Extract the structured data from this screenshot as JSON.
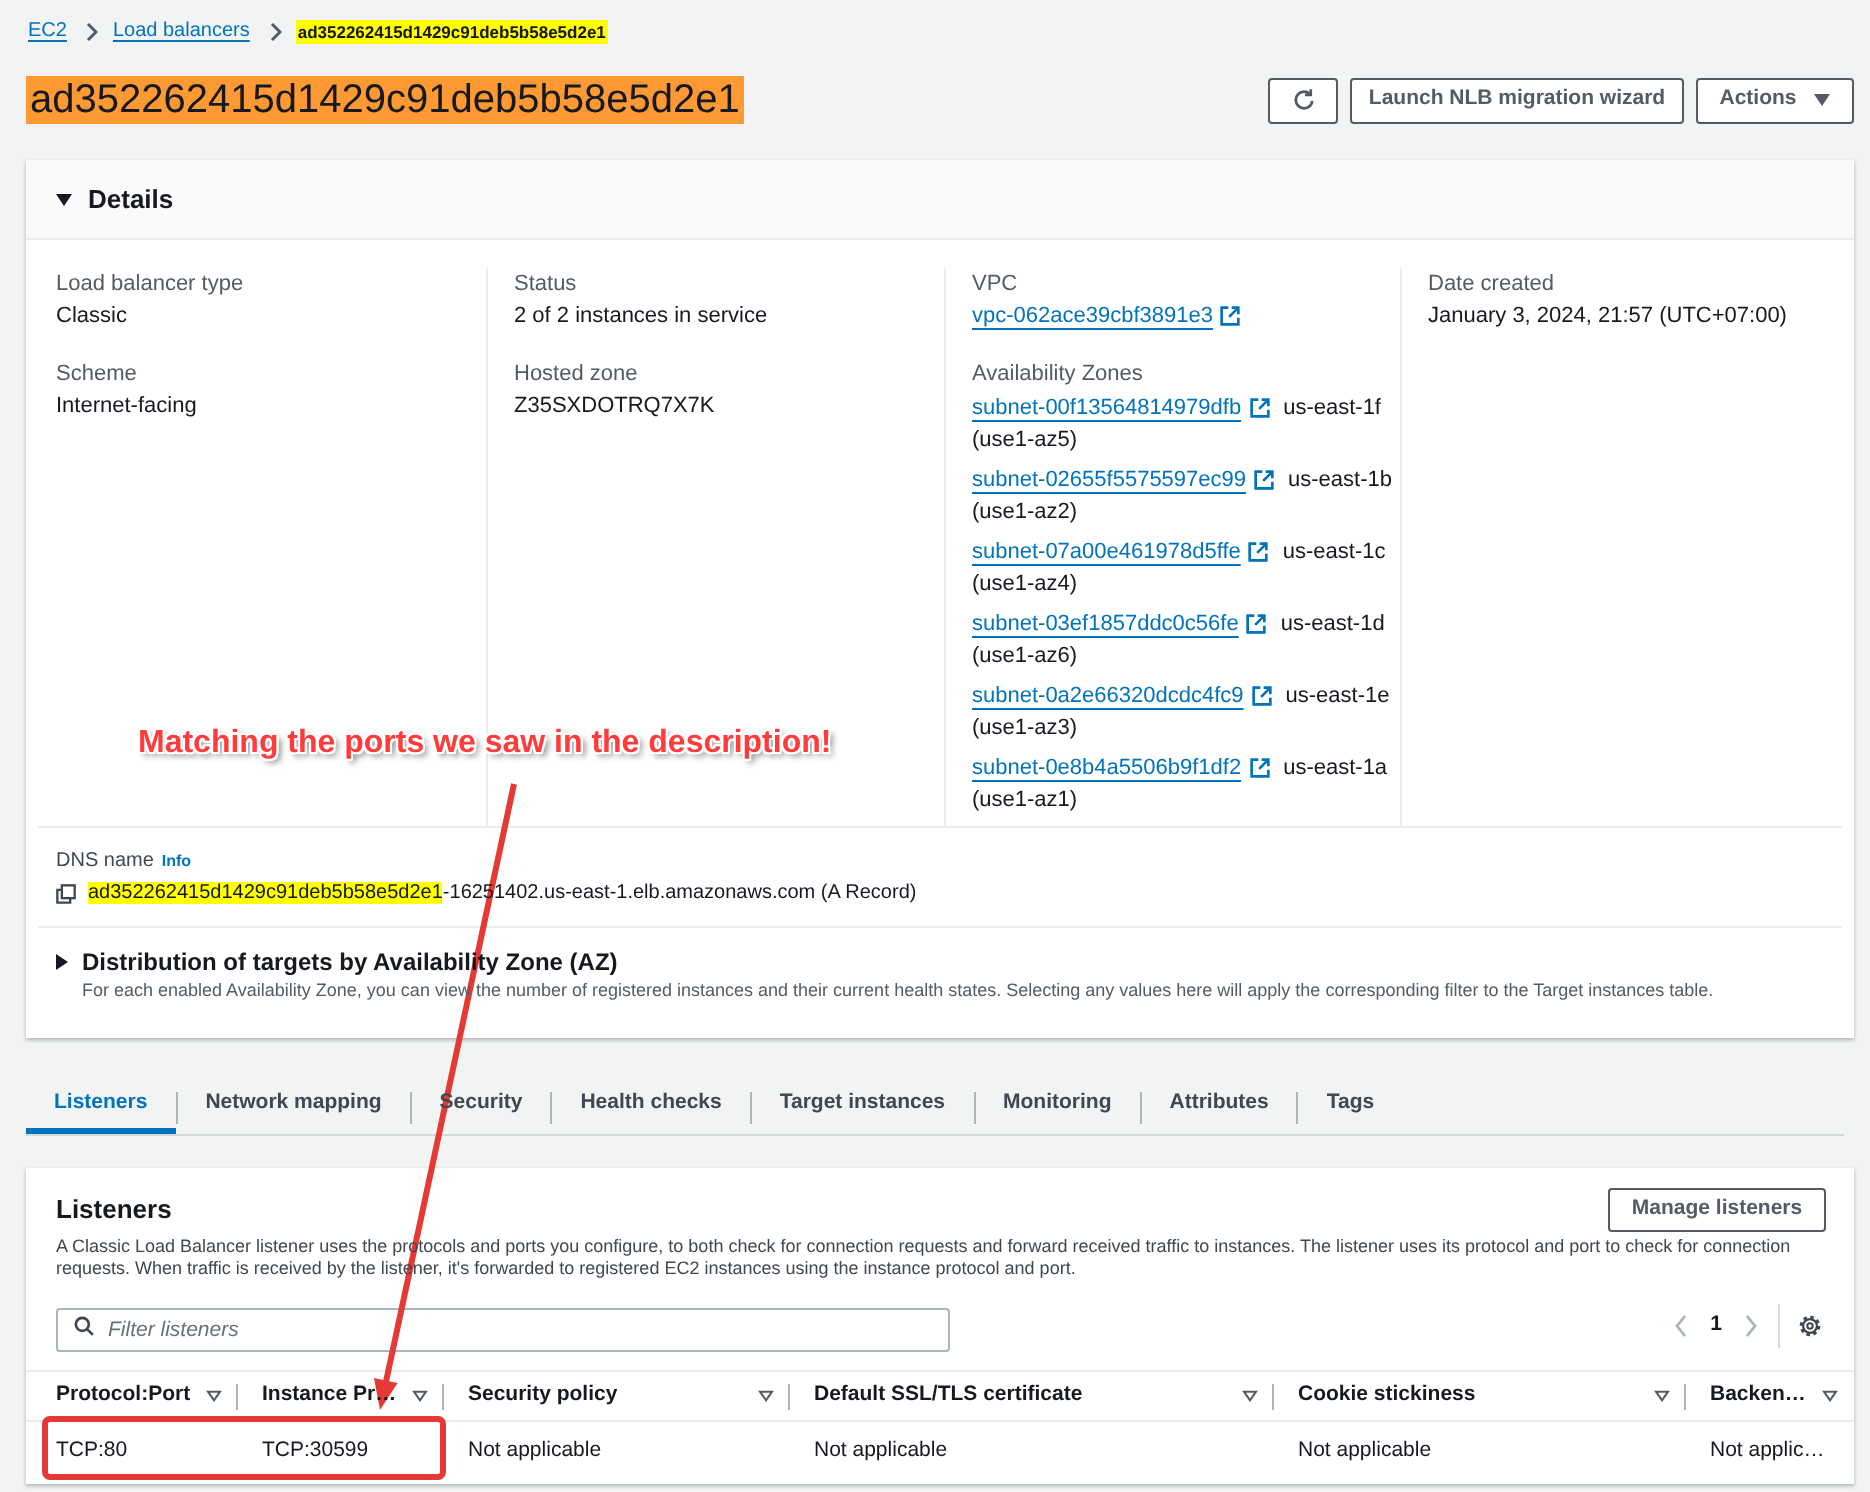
{
  "breadcrumbs": [
    {
      "label": "EC2",
      "kind": "link",
      "highlighted": false
    },
    {
      "label": "Load balancers",
      "kind": "link",
      "highlighted": false
    },
    {
      "label": "ad352262415d1429c91deb5b58e5d2e1",
      "kind": "current",
      "highlighted": true
    }
  ],
  "page_title": {
    "text": "ad352262415d1429c91deb5b58e5d2e1",
    "highlighted": true
  },
  "header_buttons": [
    {
      "kind": "refresh"
    },
    {
      "kind": "plain",
      "label": "Launch NLB migration wizard"
    },
    {
      "kind": "dropdown",
      "label": "Actions"
    }
  ],
  "details": {
    "title": "Details",
    "expanded": true,
    "columns": [
      [
        {
          "kind": "text",
          "label": "Load balancer type",
          "value": "Classic"
        },
        {
          "kind": "text",
          "label": "Scheme",
          "value": "Internet-facing"
        }
      ],
      [
        {
          "kind": "text",
          "label": "Status",
          "value": "2 of 2 instances in service"
        },
        {
          "kind": "text",
          "label": "Hosted zone",
          "value": "Z35SXDOTRQ7X7K"
        }
      ],
      [
        {
          "kind": "link",
          "label": "VPC",
          "value": "vpc-062ace39cbf3891e3"
        },
        {
          "kind": "subnets",
          "label": "Availability Zones",
          "items": [
            {
              "subnet": "subnet-00f13564814979dfb",
              "zone": "us-east-1f",
              "zone_id": "(use1-az5)"
            },
            {
              "subnet": "subnet-02655f5575597ec99",
              "zone": "us-east-1b",
              "zone_id": "(use1-az2)"
            },
            {
              "subnet": "subnet-07a00e461978d5ffe",
              "zone": "us-east-1c",
              "zone_id": "(use1-az4)"
            },
            {
              "subnet": "subnet-03ef1857ddc0c56fe",
              "zone": "us-east-1d",
              "zone_id": "(use1-az6)"
            },
            {
              "subnet": "subnet-0a2e66320dcdc4fc9",
              "zone": "us-east-1e",
              "zone_id": "(use1-az3)"
            },
            {
              "subnet": "subnet-0e8b4a5506b9f1df2",
              "zone": "us-east-1a",
              "zone_id": "(use1-az1)"
            }
          ]
        }
      ],
      [
        {
          "kind": "text",
          "label": "Date created",
          "value": "January 3, 2024, 21:57 (UTC+07:00)"
        }
      ]
    ],
    "dns_name": {
      "label": "DNS name",
      "info": "Info",
      "value_parts": [
        {
          "text": "ad352262415d1429c91deb5b58e5d2e1",
          "highlighted": true
        },
        {
          "text": "-16251402.us-east-1.elb.amazonaws.com (A Record)",
          "highlighted": false
        }
      ]
    },
    "distribution": {
      "title": "Distribution of targets by Availability Zone (AZ)",
      "expanded": false,
      "description": "For each enabled Availability Zone, you can view the number of registered instances and their current health states. Selecting any values here will apply the corresponding filter to the Target instances table."
    }
  },
  "tabs": [
    {
      "label": "Listeners",
      "selected": true
    },
    {
      "label": "Network mapping",
      "selected": false
    },
    {
      "label": "Security",
      "selected": false
    },
    {
      "label": "Health checks",
      "selected": false
    },
    {
      "label": "Target instances",
      "selected": false
    },
    {
      "label": "Monitoring",
      "selected": false
    },
    {
      "label": "Attributes",
      "selected": false
    },
    {
      "label": "Tags",
      "selected": false
    }
  ],
  "listeners": {
    "title": "Listeners",
    "button": "Manage listeners",
    "description": "A Classic Load Balancer listener uses the protocols and ports you configure, to both check for connection requests and forward received traffic to instances. The listener uses its protocol and port to check for connection requests. When traffic is received by the listener, it's forwarded to registered EC2 instances using the instance protocol and port.",
    "filter": {
      "placeholder": "Filter listeners"
    },
    "pagination": {
      "previous_disabled": true,
      "next_disabled": true,
      "pages": [
        {
          "label": "1",
          "selected": true
        }
      ]
    },
    "table": {
      "columns": [
        {
          "label": "Protocol:Port"
        },
        {
          "label": "Instance Pr…"
        },
        {
          "label": "Security policy"
        },
        {
          "label": "Default SSL/TLS certificate"
        },
        {
          "label": "Cookie stickiness"
        },
        {
          "label": "Backen…"
        }
      ],
      "rows": [
        {
          "cells": [
            "TCP:80",
            "TCP:30599",
            "Not applicable",
            "Not applicable",
            "Not applicable",
            "Not applic…"
          ]
        }
      ]
    }
  },
  "annotation": {
    "text": "Matching the ports we saw in the description!"
  }
}
